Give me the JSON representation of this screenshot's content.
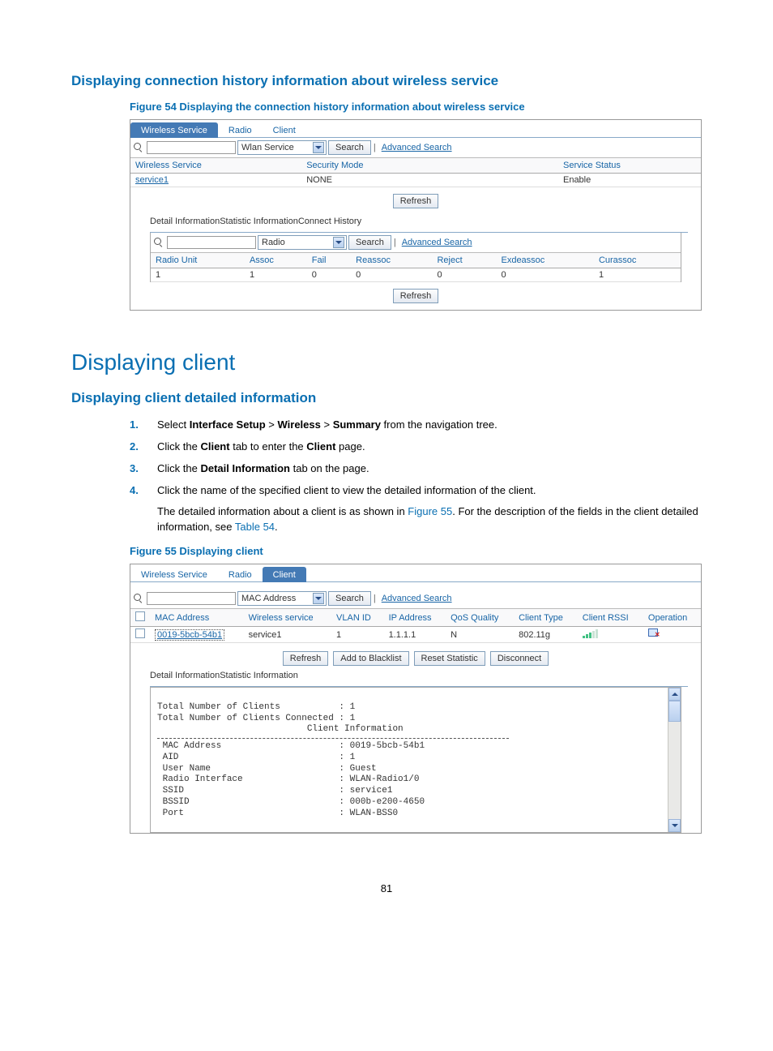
{
  "sec1_title": "Displaying connection history information about wireless service",
  "fig54_caption": "Figure 54 Displaying the connection history information about wireless service",
  "fig55_caption": "Figure 55 Displaying client",
  "tabs": {
    "wireless_service": "Wireless Service",
    "radio": "Radio",
    "client": "Client"
  },
  "searchbar": {
    "wlan_service": "Wlan Service",
    "radio": "Radio",
    "mac": "MAC Address",
    "search": "Search",
    "advanced": "Advanced Search"
  },
  "fig54_table1": {
    "headers": {
      "ws": "Wireless Service",
      "sm": "Security Mode",
      "ss": "Service Status"
    },
    "row": {
      "service": "service1",
      "mode": "NONE",
      "status": "Enable"
    }
  },
  "buttons": {
    "refresh": "Refresh",
    "add_blacklist": "Add to Blacklist",
    "reset_stat": "Reset Statistic",
    "disconnect": "Disconnect"
  },
  "subtabs": {
    "detail": "Detail Information",
    "stat": "Statistic Information",
    "connect": "Connect History"
  },
  "fig54_table2": {
    "headers": {
      "ru": "Radio Unit",
      "assoc": "Assoc",
      "fail": "Fail",
      "reassoc": "Reassoc",
      "reject": "Reject",
      "exdeassoc": "Exdeassoc",
      "curassoc": "Curassoc"
    },
    "row": {
      "ru": "1",
      "assoc": "1",
      "fail": "0",
      "reassoc": "0",
      "reject": "0",
      "exdeassoc": "0",
      "curassoc": "1"
    }
  },
  "h1": "Displaying client",
  "sec2_title": "Displaying client detailed information",
  "steps": {
    "s1a": "Select ",
    "s1b": "Interface Setup",
    "s1c": " > ",
    "s1d": "Wireless",
    "s1e": " > ",
    "s1f": "Summary",
    "s1g": " from the navigation tree.",
    "s2a": "Click the ",
    "s2b": "Client",
    "s2c": " tab to enter the ",
    "s2d": "Client",
    "s2e": " page.",
    "s3a": "Click the ",
    "s3b": "Detail Information",
    "s3c": " tab on the page.",
    "s4": "Click the name of the specified client to view the detailed information of the client."
  },
  "para": {
    "p1a": "The detailed information about a client is as shown in ",
    "p1_link1": "Figure 55",
    "p1b": ". For the description of the fields in the client detailed information, see ",
    "p1_link2": "Table 54",
    "p1c": "."
  },
  "fig55_table": {
    "headers": {
      "mac": "MAC Address",
      "ws": "Wireless service",
      "vlan": "VLAN ID",
      "ip": "IP Address",
      "qos": "QoS Quality",
      "ct": "Client Type",
      "rssi": "Client RSSI",
      "op": "Operation"
    },
    "row": {
      "mac": "0019-5bcb-54b1",
      "ws": "service1",
      "vlan": "1",
      "ip": "1.1.1.1",
      "qos": "N",
      "ct": "802.11g"
    }
  },
  "detail_text": {
    "l1": "Total Number of Clients           : 1",
    "l2": "Total Number of Clients Connected : 1",
    "l3": "                            Client Information",
    "l4": " MAC Address                      : 0019-5bcb-54b1",
    "l5": " AID                              : 1",
    "l6": " User Name                        : Guest",
    "l7": " Radio Interface                  : WLAN-Radio1/0",
    "l8": " SSID                             : service1",
    "l9": " BSSID                            : 000b-e200-4650",
    "l10": " Port                             : WLAN-BSS0"
  },
  "page_number": "81"
}
